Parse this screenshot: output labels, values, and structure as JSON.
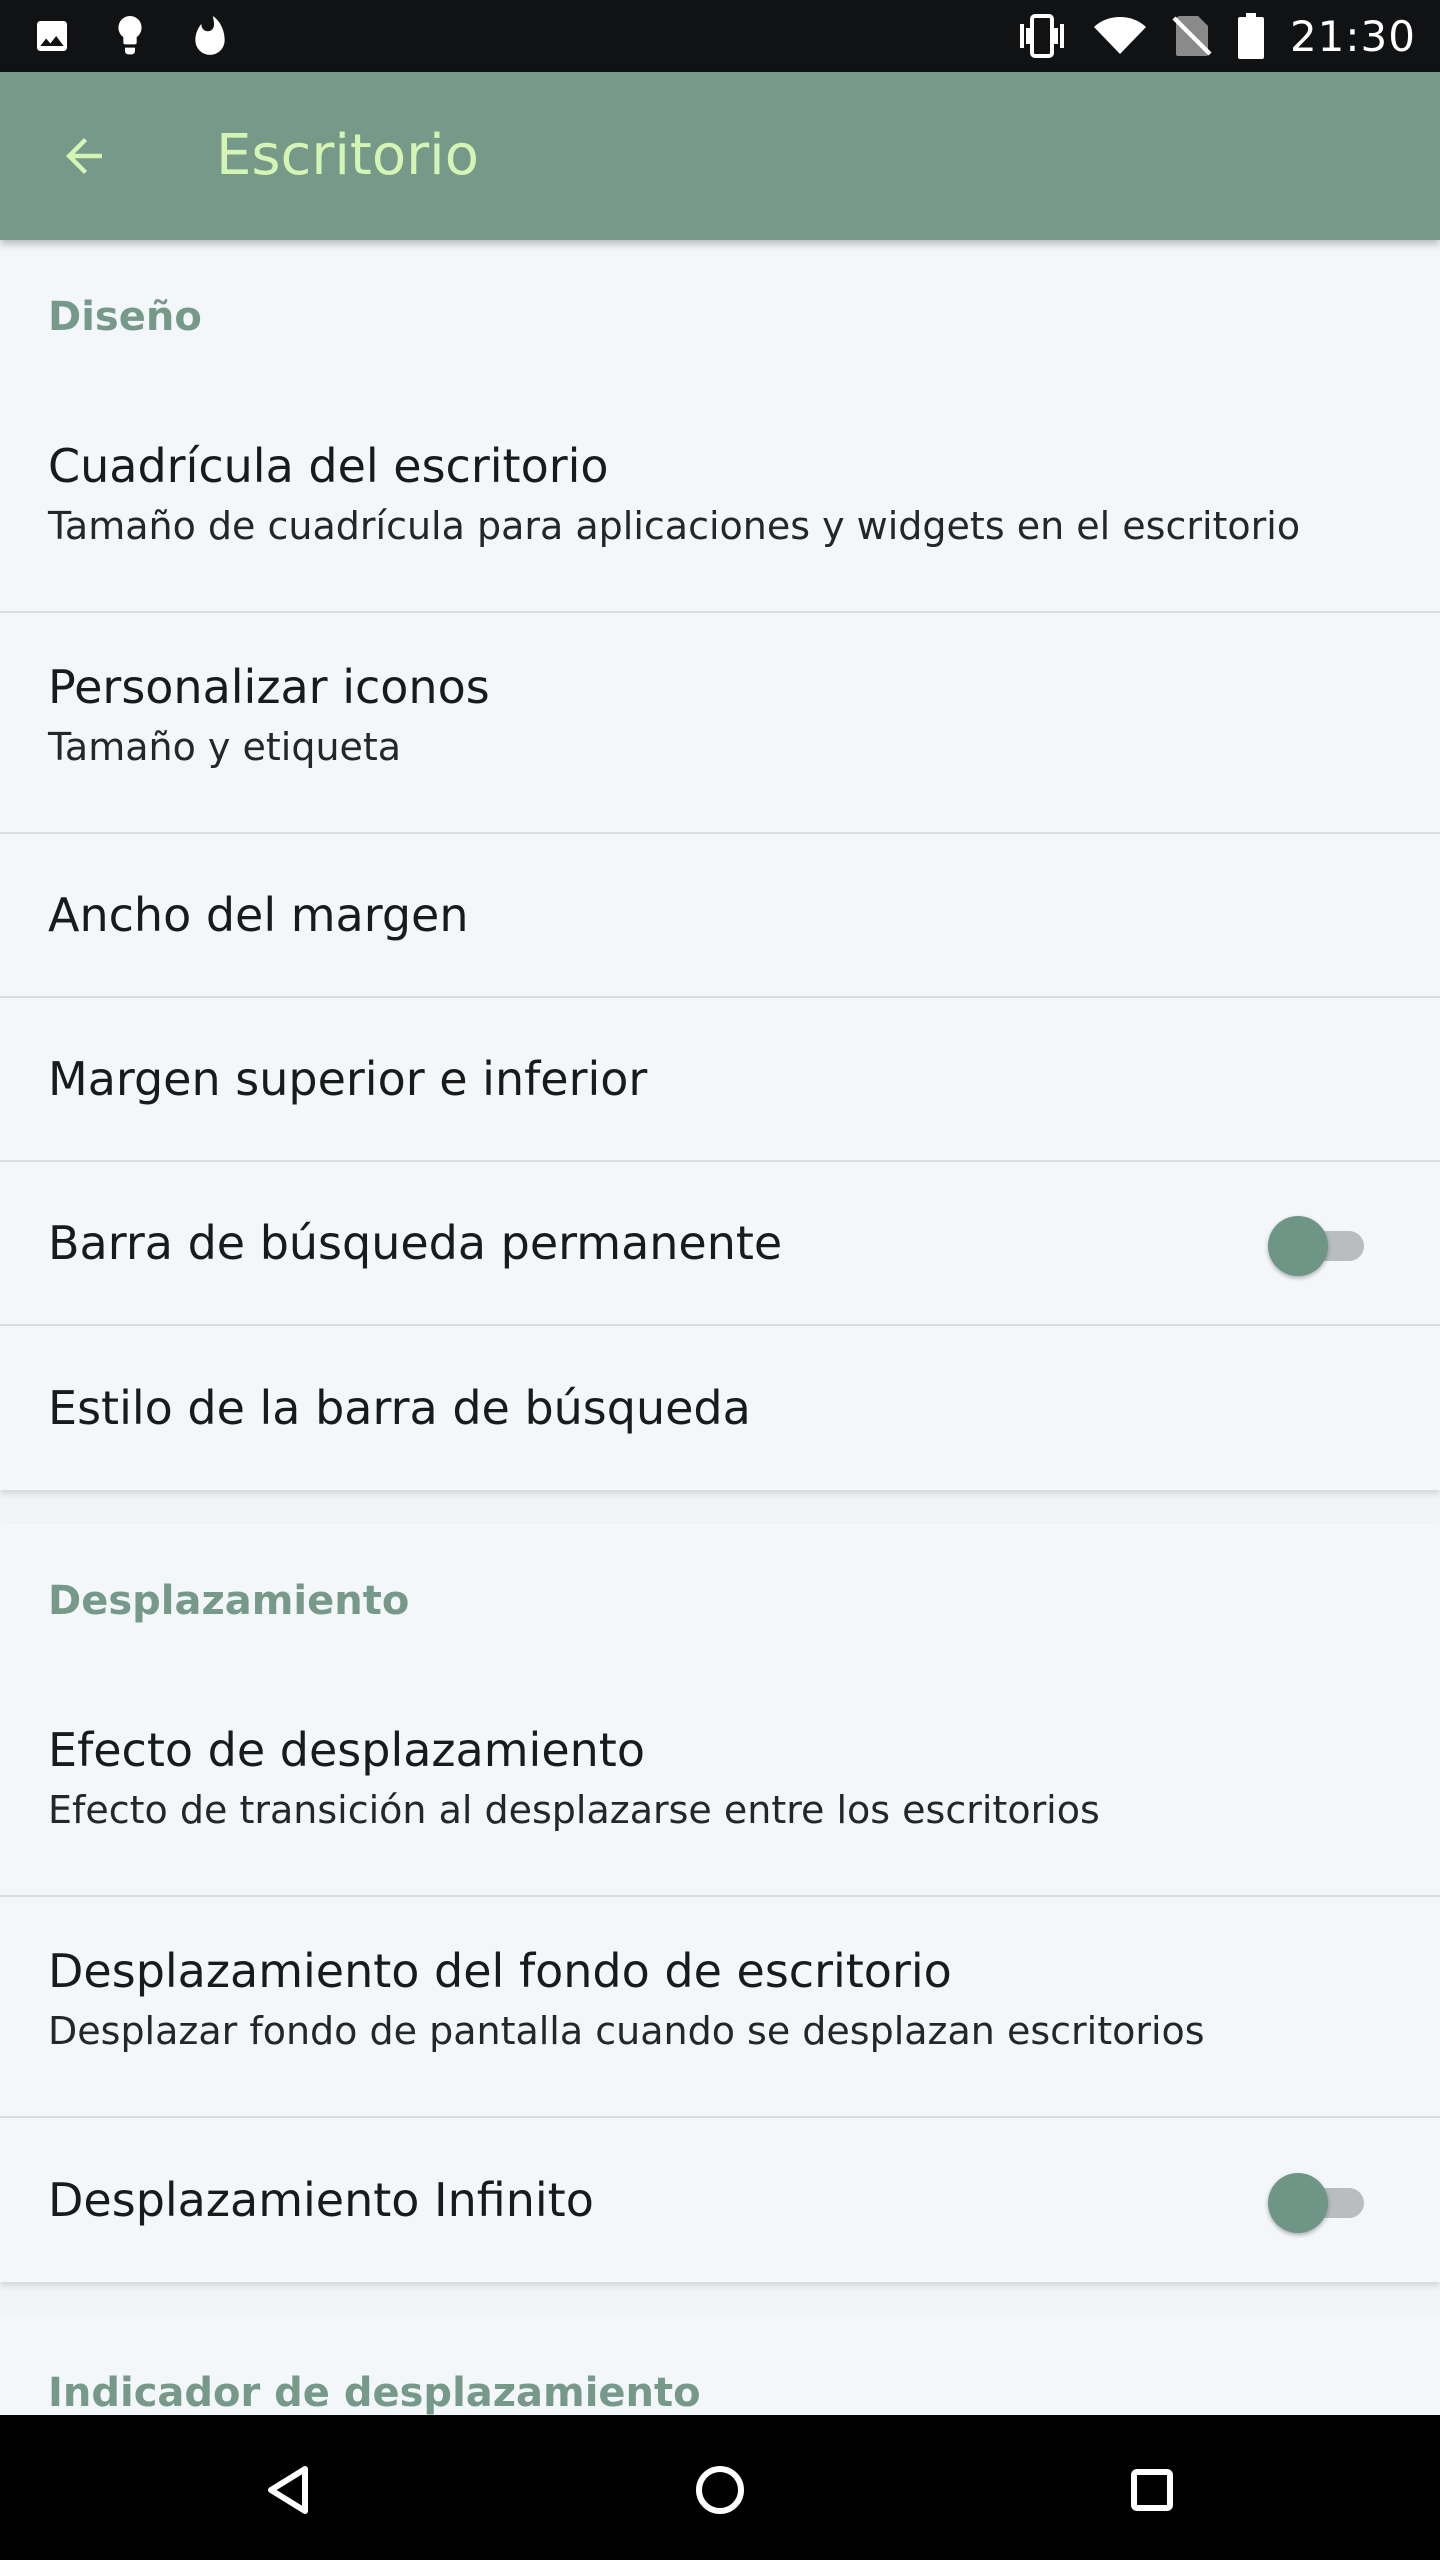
{
  "status_bar": {
    "time": "21:30",
    "left_icons": [
      "image-icon",
      "lightbulb-icon",
      "fire-icon"
    ],
    "right_icons": [
      "vibrate-icon",
      "wifi-icon",
      "no-sim-icon",
      "battery-icon"
    ]
  },
  "app_bar": {
    "title": "Escritorio",
    "back_icon": "arrow-back-icon",
    "accent_color": "#76998a",
    "title_color": "#d4f5b4"
  },
  "sections": [
    {
      "header": "Diseño",
      "items": [
        {
          "title": "Cuadrícula del escritorio",
          "summary": "Tamaño de cuadrícula para aplicaciones y widgets en el escritorio"
        },
        {
          "title": "Personalizar iconos",
          "summary": "Tamaño y etiqueta"
        },
        {
          "title": "Ancho del margen"
        },
        {
          "title": "Margen superior e inferior"
        },
        {
          "title": "Barra de búsqueda permanente",
          "toggle": false
        },
        {
          "title": "Estilo de la barra de búsqueda"
        }
      ]
    },
    {
      "header": "Desplazamiento",
      "items": [
        {
          "title": "Efecto de desplazamiento",
          "summary": "Efecto de transición al desplazarse entre los escritorios"
        },
        {
          "title": "Desplazamiento del fondo de escritorio",
          "summary": "Desplazar fondo de pantalla cuando se desplazan escritorios"
        },
        {
          "title": "Desplazamiento Infinito",
          "toggle": false
        }
      ]
    },
    {
      "header": "Indicador de desplazamiento",
      "items": []
    }
  ],
  "nav_bar": {
    "buttons": [
      "back-triangle-icon",
      "home-circle-icon",
      "recents-square-icon"
    ]
  }
}
